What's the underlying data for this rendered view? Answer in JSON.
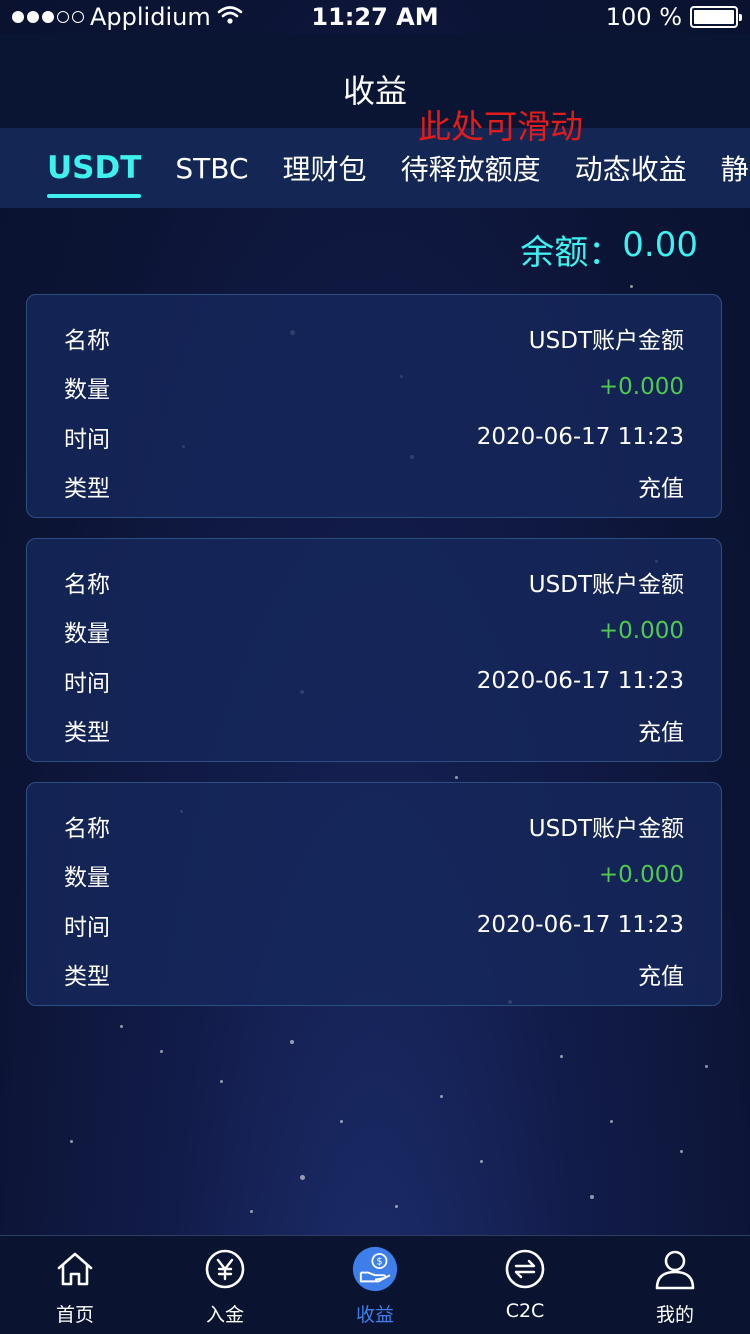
{
  "status_bar": {
    "carrier": "Applidium",
    "time": "11:27 AM",
    "battery_percent": "100 %"
  },
  "header": {
    "title": "收益"
  },
  "scroll_hint": "此处可滑动",
  "tabs": [
    {
      "label": "USDT",
      "active": true
    },
    {
      "label": "STBC",
      "active": false
    },
    {
      "label": "理财包",
      "active": false
    },
    {
      "label": "待释放额度",
      "active": false
    },
    {
      "label": "动态收益",
      "active": false
    },
    {
      "label": "静态收益",
      "active": false
    }
  ],
  "balance": {
    "label": "余额：",
    "value": "0.00"
  },
  "records": [
    {
      "name_label": "名称",
      "name_value": "USDT账户金额",
      "amount_label": "数量",
      "amount_value": "+0.000",
      "time_label": "时间",
      "time_value": "2020-06-17 11:23",
      "type_label": "类型",
      "type_value": "充值"
    },
    {
      "name_label": "名称",
      "name_value": "USDT账户金额",
      "amount_label": "数量",
      "amount_value": "+0.000",
      "time_label": "时间",
      "time_value": "2020-06-17 11:23",
      "type_label": "类型",
      "type_value": "充值"
    },
    {
      "name_label": "名称",
      "name_value": "USDT账户金额",
      "amount_label": "数量",
      "amount_value": "+0.000",
      "time_label": "时间",
      "time_value": "2020-06-17 11:23",
      "type_label": "类型",
      "type_value": "充值"
    }
  ],
  "tabbar": [
    {
      "label": "首页",
      "icon": "home-icon",
      "active": false
    },
    {
      "label": "入金",
      "icon": "yen-circle-icon",
      "active": false
    },
    {
      "label": "收益",
      "icon": "income-hand-icon",
      "active": true
    },
    {
      "label": "C2C",
      "icon": "exchange-icon",
      "active": false
    },
    {
      "label": "我的",
      "icon": "user-icon",
      "active": false
    }
  ],
  "colors": {
    "accent_cyan": "#3ef0ee",
    "positive_green": "#4fc94f",
    "hint_red": "#e01c1c",
    "tab_active_blue": "#3d7ee8"
  }
}
